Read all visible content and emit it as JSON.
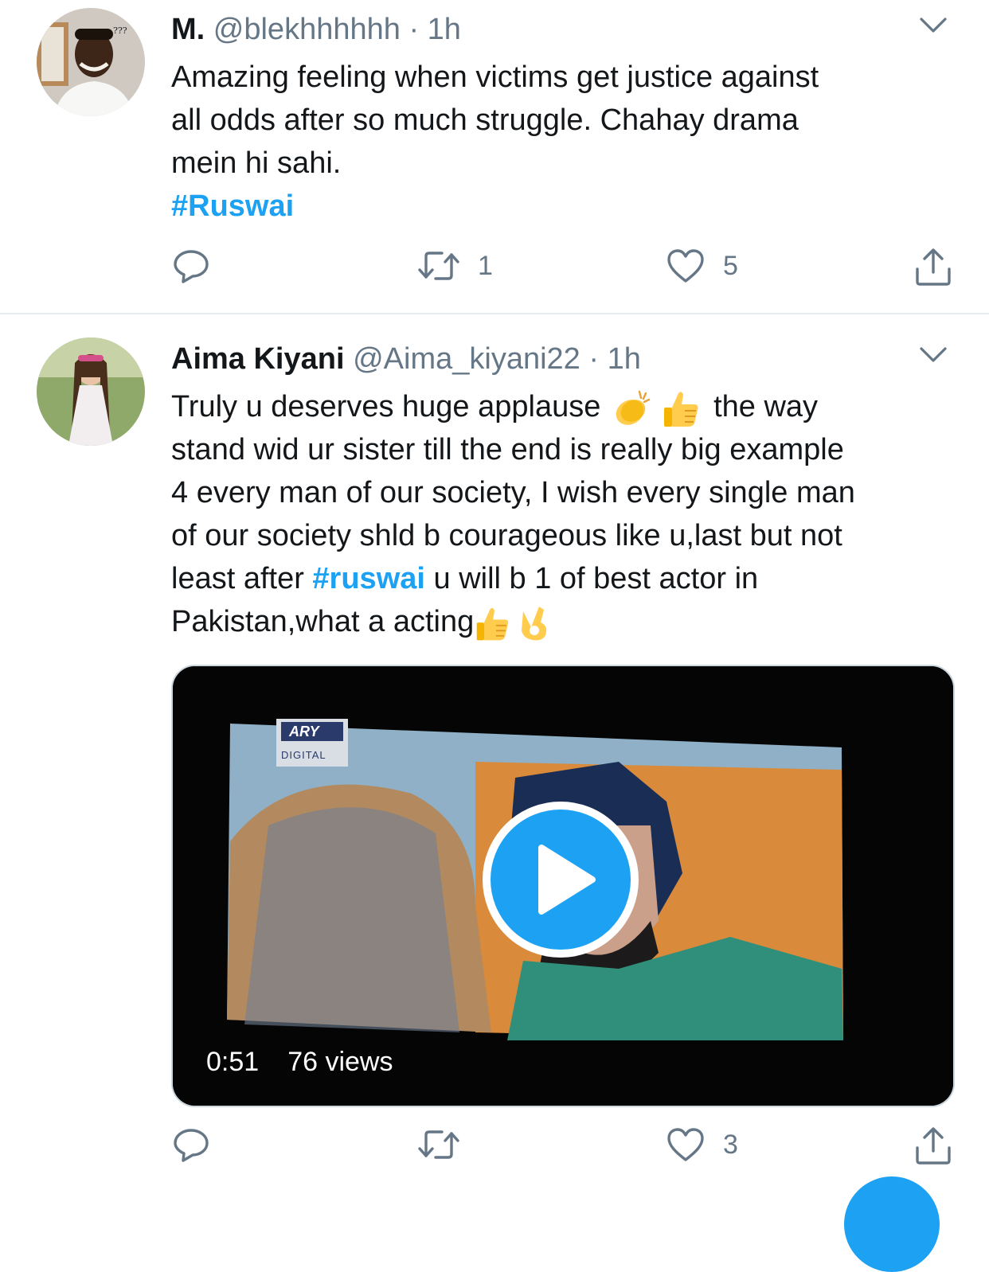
{
  "tweets": [
    {
      "name": "M.",
      "handle": "@blekhhhhhh",
      "separator": "·",
      "time": "1h",
      "text_line1": "Amazing feeling when victims get justice against",
      "text_line2": "all odds after so much struggle. Chahay drama",
      "text_line3": "mein hi sahi.",
      "hashtag": "#Ruswai",
      "retweet_count": "1",
      "like_count": "5",
      "avatar_badge_text": "???"
    },
    {
      "name": "Aima Kiyani",
      "handle": "@Aima_kiyani22",
      "separator": "·",
      "time": "1h",
      "text_part1": "Truly u deserves huge applause",
      "text_part2": "the way",
      "text_line2": "stand wid ur sister till the end is really big example",
      "text_line3": "4 every man of our society, I wish every single man",
      "text_line4": "of our society shld b courageous like u,last but not",
      "text_line5_pre": "least after ",
      "hashtag": "#ruswai",
      "text_line5_post": " u will b 1 of best actor in",
      "text_line6": "Pakistan,what a acting",
      "video": {
        "duration": "0:51",
        "views": "76 views",
        "channel_logo_top": "ARY",
        "channel_logo_bottom": "DIGITAL"
      },
      "retweet_count": "",
      "like_count": "3"
    }
  ],
  "icons": [
    "reply-icon",
    "retweet-icon",
    "like-icon",
    "share-icon",
    "chevron-down-icon",
    "play-icon",
    "clap-emoji",
    "thumbs-up-emoji",
    "ok-hand-emoji"
  ],
  "colors": {
    "accent": "#1da1f2",
    "secondary_text": "#657786",
    "divider": "#e6ecf0"
  }
}
